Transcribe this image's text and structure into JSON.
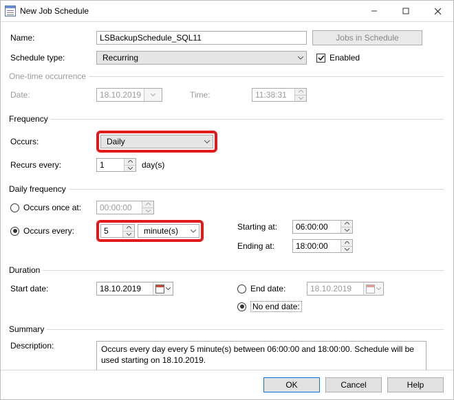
{
  "window": {
    "title": "New Job Schedule"
  },
  "win_buttons": {
    "min": "Minimize",
    "max": "Maximize",
    "close": "Close"
  },
  "labels": {
    "name": "Name:",
    "schedule_type": "Schedule type:",
    "enabled": "Enabled",
    "jobs_in_schedule": "Jobs in Schedule",
    "one_time_group": "One-time occurrence",
    "date": "Date:",
    "time": "Time:",
    "frequency_group": "Frequency",
    "occurs": "Occurs:",
    "recurs_every": "Recurs every:",
    "days_unit": "day(s)",
    "daily_freq_group": "Daily frequency",
    "occurs_once_at": "Occurs once at:",
    "occurs_every": "Occurs every:",
    "starting_at": "Starting at:",
    "ending_at": "Ending at:",
    "duration_group": "Duration",
    "start_date": "Start date:",
    "end_date": "End date:",
    "no_end_date": "No end date:",
    "summary_group": "Summary",
    "description": "Description:"
  },
  "values": {
    "name": "LSBackupSchedule_SQL11",
    "schedule_type": "Recurring",
    "enabled": true,
    "one_time_date": "18.10.2019",
    "one_time_time": "11:38:31",
    "occurs": "Daily",
    "recurs_every": "1",
    "occurs_once_time": "00:00:00",
    "occurs_every_value": "5",
    "occurs_every_unit": "minute(s)",
    "starting_at": "06:00:00",
    "ending_at": "18:00:00",
    "start_date": "18.10.2019",
    "end_date": "18.10.2019",
    "daily_freq_mode": "every",
    "duration_mode": "no_end",
    "summary": "Occurs every day every 5 minute(s) between 06:00:00 and 18:00:00. Schedule will be used starting on 18.10.2019."
  },
  "buttons": {
    "ok": "OK",
    "cancel": "Cancel",
    "help": "Help"
  }
}
